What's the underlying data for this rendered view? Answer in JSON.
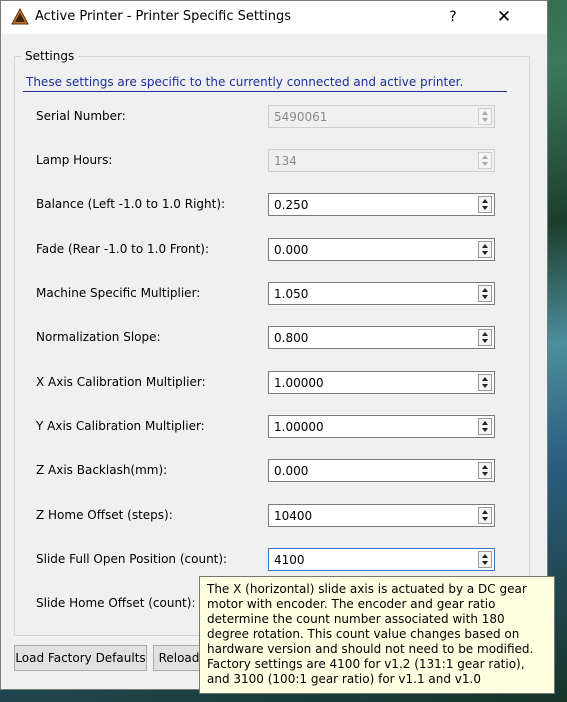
{
  "window": {
    "title": "Active Printer - Printer Specific Settings",
    "help_label": "?",
    "close_label": "✕"
  },
  "settings": {
    "group_label": "Settings",
    "info": "These settings are specific to the currently connected and active printer.",
    "fields": [
      {
        "label": "Serial Number:",
        "value": "5490061",
        "enabled": false
      },
      {
        "label": "Lamp Hours:",
        "value": "134",
        "enabled": false
      },
      {
        "label": "Balance (Left -1.0 to 1.0 Right):",
        "value": "0.250",
        "enabled": true
      },
      {
        "label": "Fade (Rear -1.0 to 1.0 Front):",
        "value": "0.000",
        "enabled": true
      },
      {
        "label": "Machine Specific Multiplier:",
        "value": "1.050",
        "enabled": true
      },
      {
        "label": "Normalization Slope:",
        "value": "0.800",
        "enabled": true
      },
      {
        "label": "X Axis Calibration Multiplier:",
        "value": "1.00000",
        "enabled": true
      },
      {
        "label": "Y Axis Calibration Multiplier:",
        "value": "1.00000",
        "enabled": true
      },
      {
        "label": "Z Axis Backlash(mm):",
        "value": "0.000",
        "enabled": true
      },
      {
        "label": "Z Home Offset (steps):",
        "value": "10400",
        "enabled": true
      },
      {
        "label": "Slide Full Open Position (count):",
        "value": "4100",
        "enabled": true
      },
      {
        "label": "Slide Home Offset (count):",
        "value": "",
        "enabled": true
      }
    ]
  },
  "buttons": {
    "load_defaults": "Load Factory Defaults",
    "reload": "Reload"
  },
  "tooltip": {
    "text": "The X (horizontal) slide axis is actuated by a DC gear motor with encoder.  The encoder and gear ratio determine the count number associated with 180 degree rotation.  This count value changes based on hardware version and should not need to be modified.  Factory settings are 4100 for v1.2 (131:1 gear ratio), and 3100 (100:1 gear ratio) for v1.1 and v1.0"
  }
}
